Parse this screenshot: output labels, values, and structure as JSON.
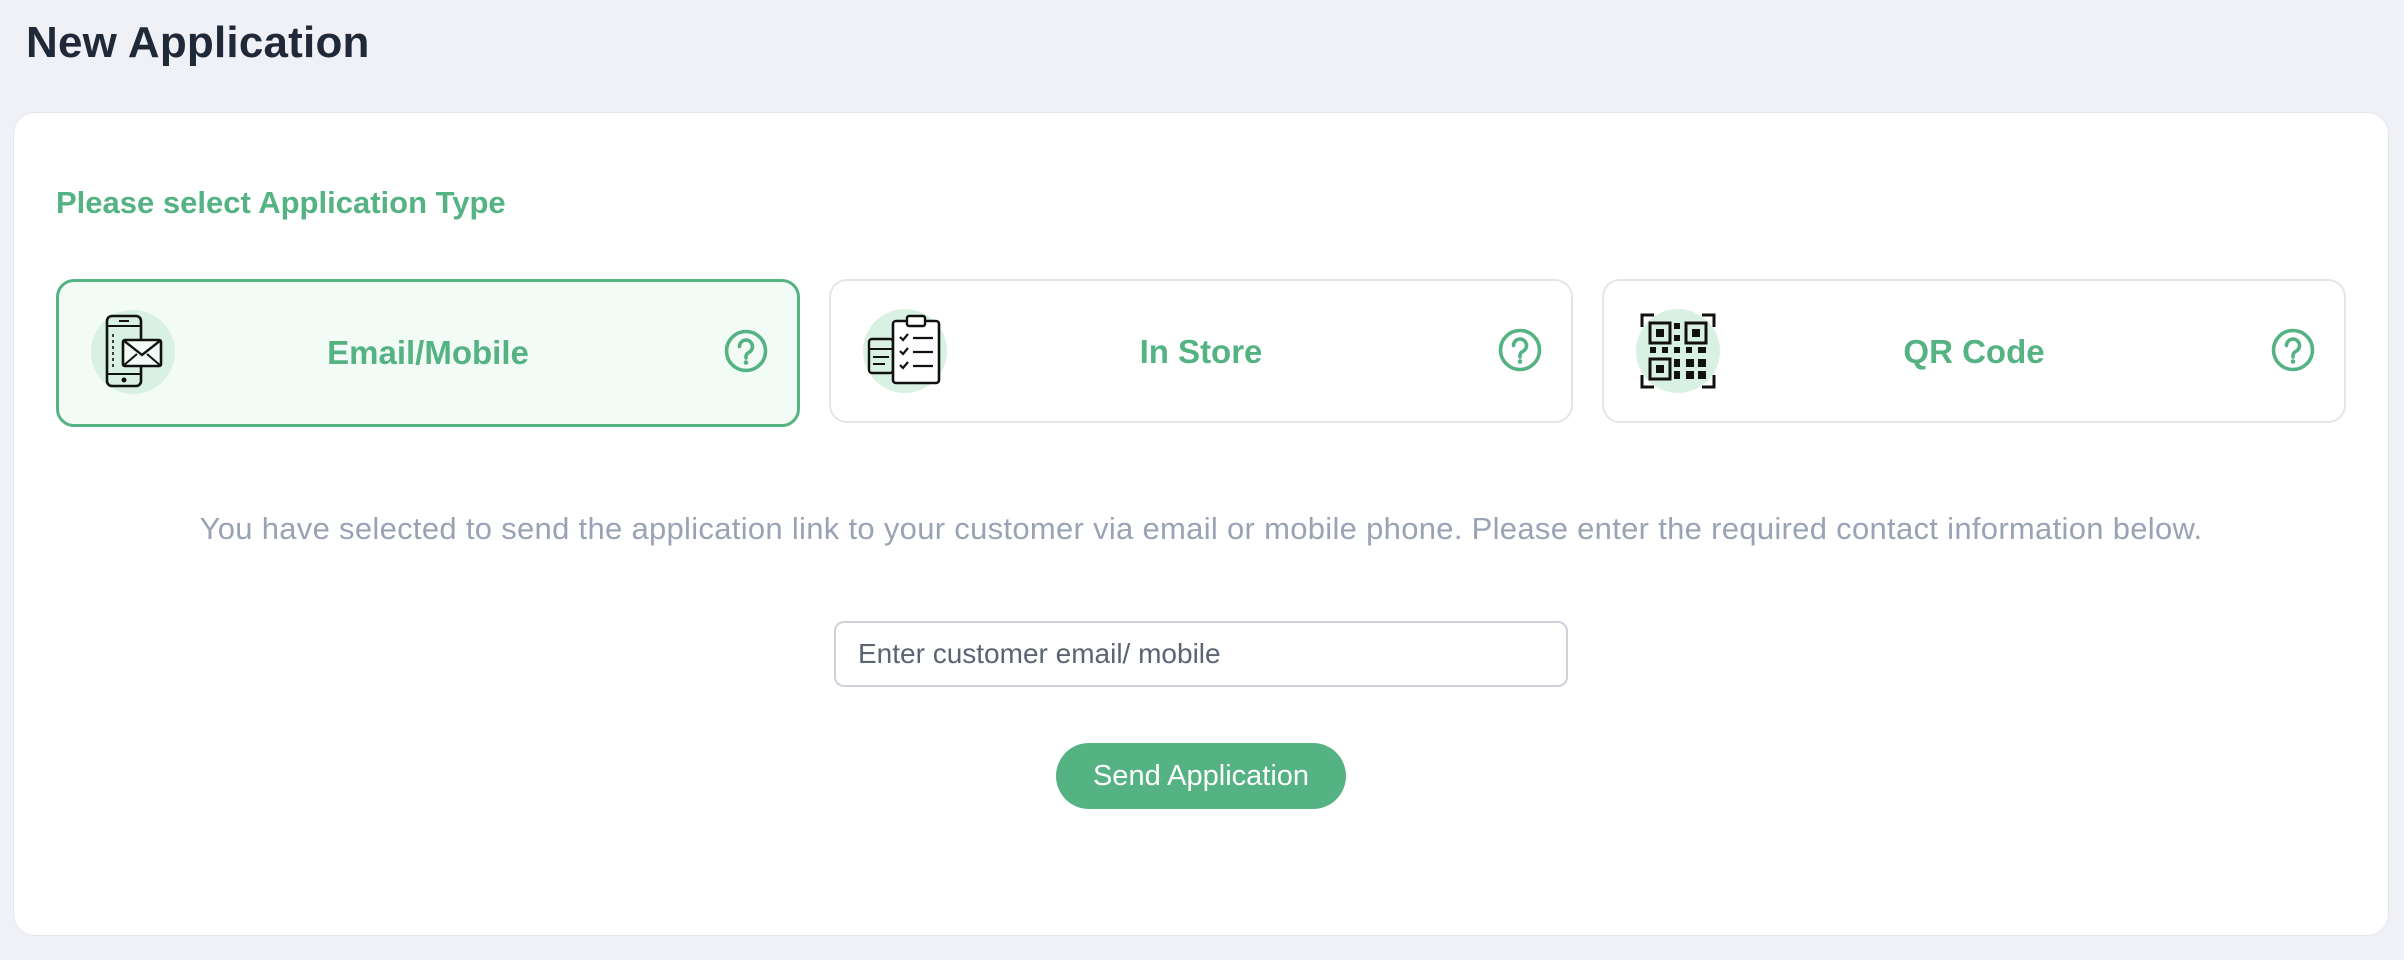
{
  "page": {
    "title": "New Application"
  },
  "application_type": {
    "prompt": "Please select Application Type",
    "options": [
      {
        "label": "Email/Mobile",
        "icon": "phone-email-icon",
        "selected": true
      },
      {
        "label": "In Store",
        "icon": "store-checklist-icon",
        "selected": false
      },
      {
        "label": "QR Code",
        "icon": "qr-code-icon",
        "selected": false
      }
    ]
  },
  "main": {
    "description": "You have selected to send the application link to your customer via email or mobile phone. Please enter the required contact information below.",
    "contact_placeholder": "Enter customer email/ mobile",
    "send_label": "Send Application"
  },
  "colors": {
    "accent": "#54b283",
    "accent_light": "#d9f1e3",
    "selected_bg": "#f3fbf6",
    "page_bg": "#eff1f6",
    "muted_text": "#9aa3b5",
    "title_text": "#1f2937"
  }
}
